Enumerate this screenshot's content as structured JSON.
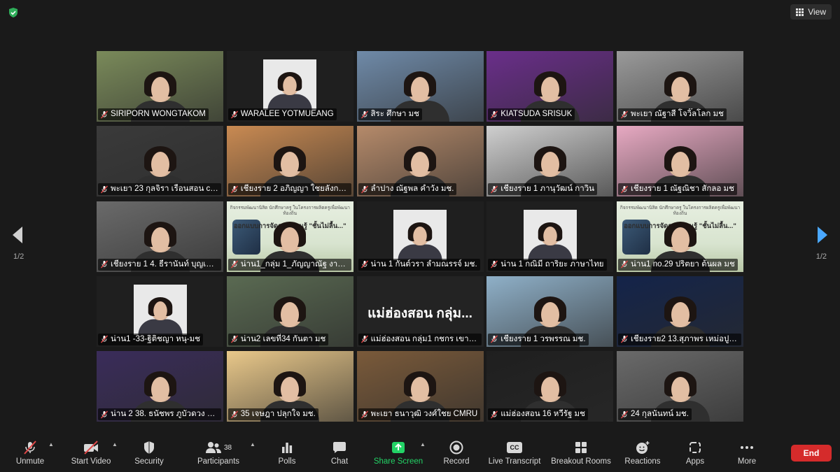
{
  "meeting": {
    "view_label": "View",
    "page_left": "1/2",
    "page_right": "1/2"
  },
  "tiles": [
    {
      "name": "SIRIPORN WONGTAKOM",
      "bg": "#7a8a5a",
      "kind": "person"
    },
    {
      "name": "WARALEE YOTMUEANG",
      "bg": "#1f1f1f",
      "kind": "photo"
    },
    {
      "name": "สิระ ศึกษา มช",
      "bg": "#6f8aa8",
      "kind": "person"
    },
    {
      "name": "KIATSUDA SRISUK",
      "bg": "#6a2e8a",
      "kind": "person",
      "active": true
    },
    {
      "name": "พะเยา ณัฐาสี โจวิ๊ลโลก มช",
      "bg": "#9a9a9a",
      "kind": "person"
    },
    {
      "name": "พะเยา 23 กุลจิรา เรือนสอน cmru",
      "bg": "#3a3a3a",
      "kind": "person"
    },
    {
      "name": "เชียงราย 2 อภิญญา ใชยลังการ มช",
      "bg": "#c98a52",
      "kind": "person"
    },
    {
      "name": "ลำปาง ณัฐพล คำวัง มช.",
      "bg": "#b58a6a",
      "kind": "person"
    },
    {
      "name": "เชียงราย 1 ภานุวัฒน์ กาวิน",
      "bg": "#cfcfcf",
      "kind": "person"
    },
    {
      "name": "เชียงราย 1 ณัฐณิชา สักลอ มช",
      "bg": "#e7a9c2",
      "kind": "person"
    },
    {
      "name": "เชียงราย 1 4. ธีรานันท์ บุญเมือง มช",
      "bg": "#6a6a6a",
      "kind": "person"
    },
    {
      "name": "น่าน1_กลุ่ม 1_ภัญญาณัฐ งานนิ...",
      "bg": "#dfe8d8",
      "kind": "poster"
    },
    {
      "name": "น่าน 1 กันต์วรา ลำมณรรจ์ มช.",
      "bg": "#1f1f1f",
      "kind": "photo"
    },
    {
      "name": "น่าน 1 กณิมี ถาริยะ ภาษาไทย",
      "bg": "#1f1f1f",
      "kind": "photo"
    },
    {
      "name": "น่าน1 no.29 ปริตยา ต้นผล มช",
      "bg": "#dfe8d8",
      "kind": "poster"
    },
    {
      "name": "น่าน1 -33-ฐิติชญา หนุ-มช",
      "bg": "#1f1f1f",
      "kind": "photo"
    },
    {
      "name": "น่าน2 เลขที่34 กันตา มช",
      "bg": "#5a6a52",
      "kind": "person"
    },
    {
      "name": "แม่ฮ่องสอน กลุ่ม1 กชกร เขาสพื้ท...",
      "bg": "#232323",
      "kind": "text",
      "big": "แม่ฮ่องสอน กลุ่ม..."
    },
    {
      "name": "เชียงราย 1 วรพรรณ มช.",
      "bg": "#8fb0c8",
      "kind": "person"
    },
    {
      "name": "เชียงราย2 13.สุภาพร เหม่อปู มหา...",
      "bg": "#14244a",
      "kind": "person"
    },
    {
      "name": "น่าน 2 38. ธนัชพร ภูบัวดวง มหา...",
      "bg": "#3a2c5a",
      "kind": "person"
    },
    {
      "name": "35 เจษฎา ปลุกใจ มช.",
      "bg": "#e9c88a",
      "kind": "person"
    },
    {
      "name": "พะเยา ธนาวุฒิ วงศ์ใชย CMRU",
      "bg": "#7a5a3a",
      "kind": "person"
    },
    {
      "name": "แม่ฮ่องสอน 16 หวีรัฐ มช",
      "bg": "#1f1f1f",
      "kind": "person"
    },
    {
      "name": "24 กุลนันทน์ มช.",
      "bg": "#6a6a6a",
      "kind": "person"
    }
  ],
  "poster": {
    "title_small": "กิจกรรมพัฒนานิสิต นักศึกษาครู ในโครงการผลิตครูเพื่อพัฒนาท้องถิ่น",
    "title_big": "ออกแบบการจัดการเรียนรู้ \"ชั้นไม่ลื้น...\""
  },
  "toolbar": {
    "unmute": "Unmute",
    "start_video": "Start Video",
    "security": "Security",
    "participants": "Participants",
    "participants_count": "38",
    "polls": "Polls",
    "chat": "Chat",
    "share_screen": "Share Screen",
    "record": "Record",
    "live_transcript": "Live Transcript",
    "breakout_rooms": "Breakout Rooms",
    "reactions": "Reactions",
    "apps": "Apps",
    "more": "More",
    "end": "End",
    "cc_badge": "CC"
  },
  "colors": {
    "share_green": "#23d366",
    "end_red": "#d52b2b",
    "active_speaker": "#c9e04a",
    "muted_red": "#e04848"
  }
}
